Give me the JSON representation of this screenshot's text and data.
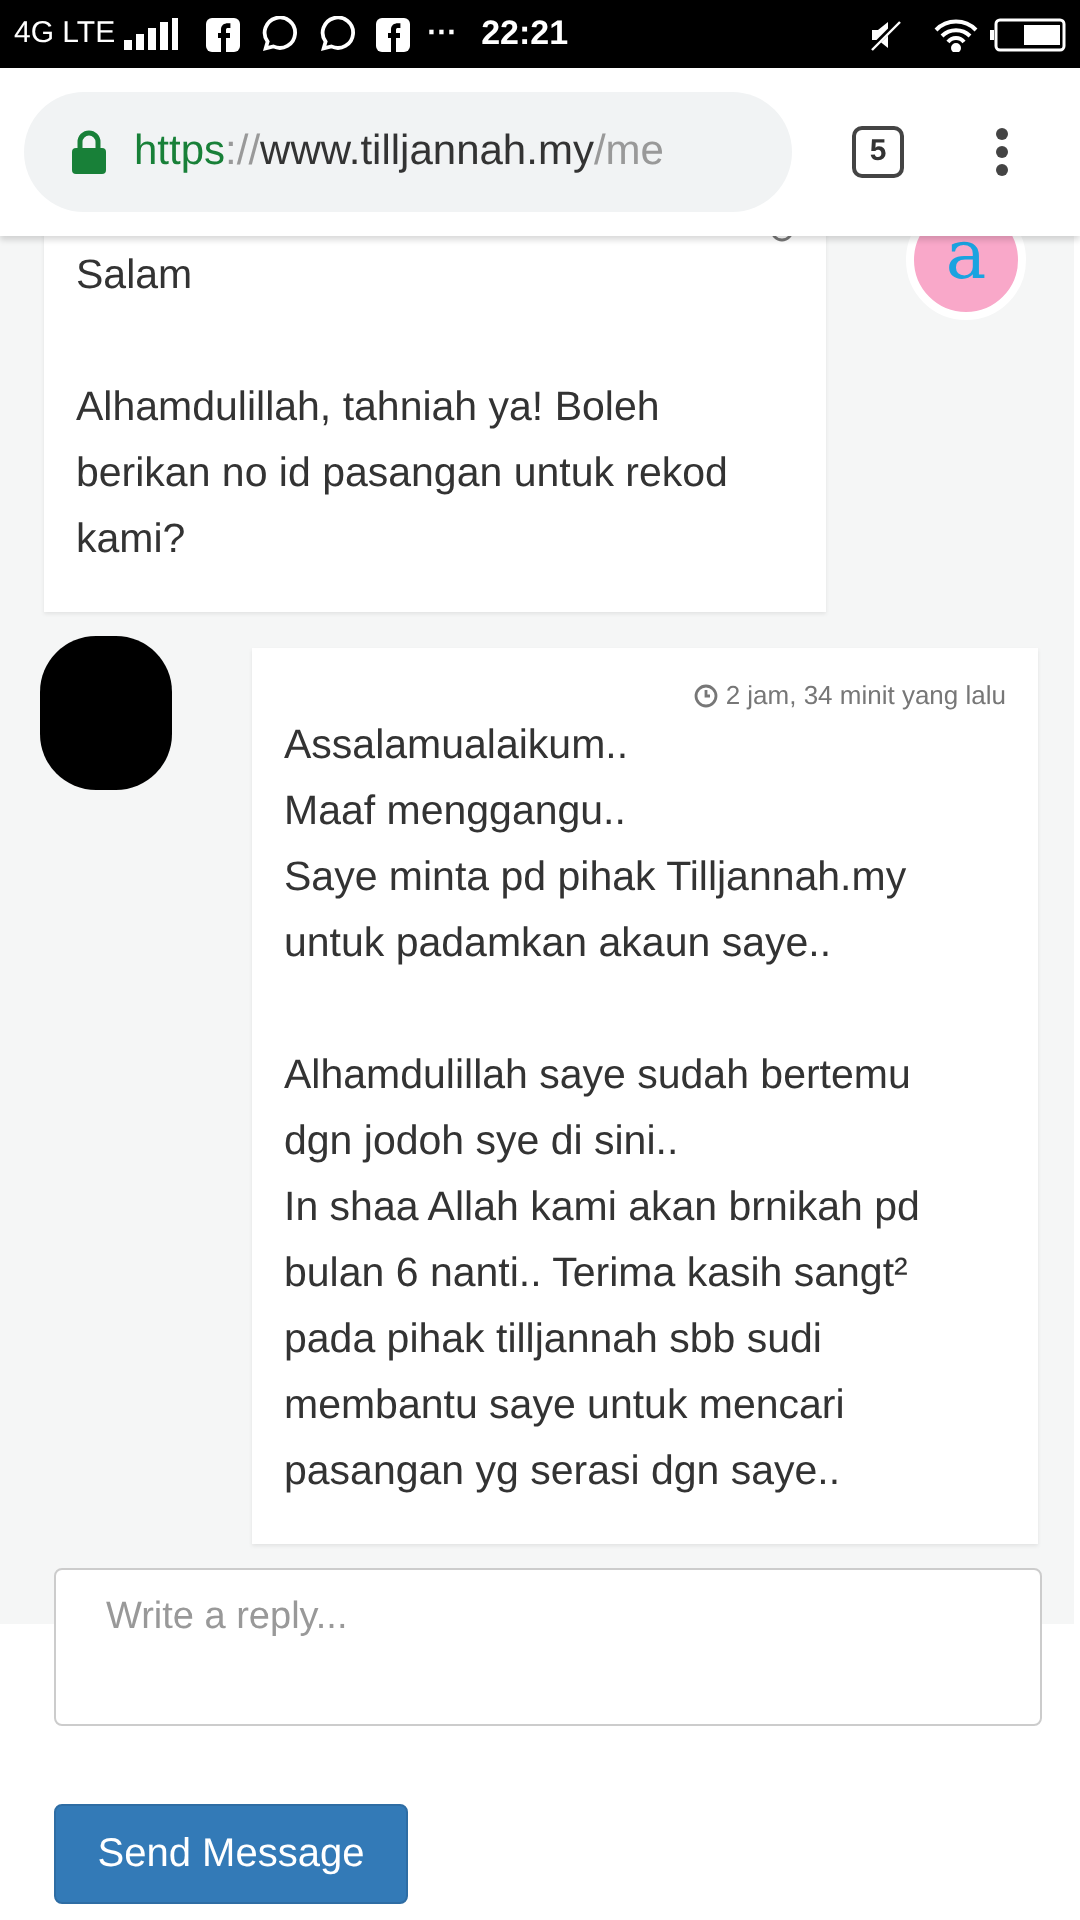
{
  "status_bar": {
    "network": "4G LTE",
    "time": "22:21",
    "more": "···"
  },
  "browser": {
    "url": {
      "scheme": "https",
      "separator": "://",
      "host": "www.tilljannah.my",
      "path": "/me"
    },
    "tab_count": "5"
  },
  "messages": [
    {
      "kind": "left",
      "avatar_letter": "a",
      "text": "Salam\n\nAlhamdulillah, tahniah ya! Boleh berikan no id pasangan untuk rekod kami?"
    },
    {
      "kind": "right",
      "time": "2 jam, 34 minit yang lalu",
      "text": "Assalamualaikum..\nMaaf menggangu..\nSaye minta pd pihak Tilljannah.my untuk padamkan akaun saye..\n\nAlhamdulillah saye sudah bertemu dgn jodoh sye di sini..\nIn shaa Allah kami akan brnikah pd bulan 6 nanti.. Terima kasih sangt² pada pihak tilljannah sbb sudi membantu saye untuk mencari pasangan yg serasi dgn saye.."
    }
  ],
  "reply": {
    "placeholder": "Write a reply..."
  },
  "send_button": "Send Message"
}
